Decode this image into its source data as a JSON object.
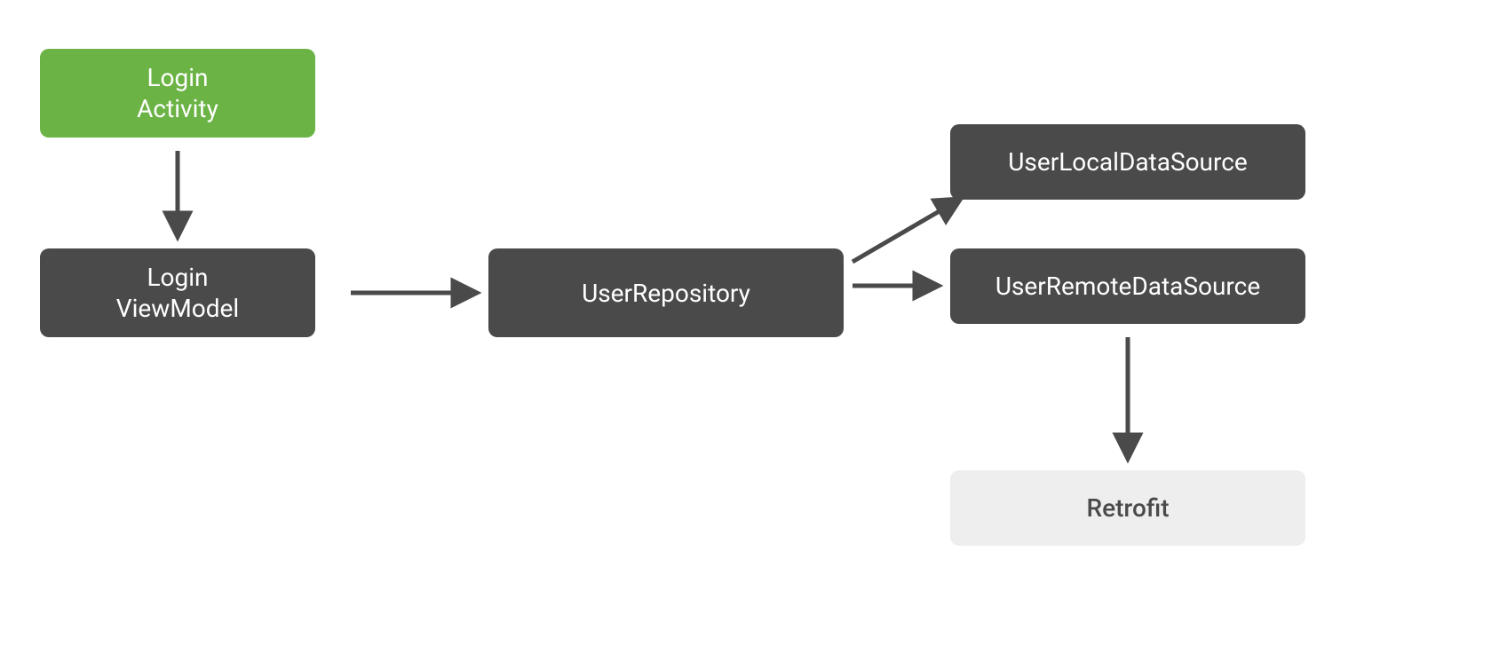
{
  "nodes": {
    "loginActivity": {
      "line1": "Login",
      "line2": "Activity"
    },
    "loginViewModel": {
      "line1": "Login",
      "line2": "ViewModel"
    },
    "userRepository": {
      "label": "UserRepository"
    },
    "userLocal": {
      "label": "UserLocalDataSource"
    },
    "userRemote": {
      "label": "UserRemoteDataSource"
    },
    "retrofit": {
      "label": "Retrofit"
    }
  },
  "diagram": {
    "type": "dependency-graph",
    "edges": [
      {
        "from": "loginActivity",
        "to": "loginViewModel"
      },
      {
        "from": "loginViewModel",
        "to": "userRepository"
      },
      {
        "from": "userRepository",
        "to": "userLocal"
      },
      {
        "from": "userRepository",
        "to": "userRemote"
      },
      {
        "from": "userRemote",
        "to": "retrofit"
      }
    ]
  },
  "colors": {
    "green": "#6ab344",
    "dark": "#4a4a4a",
    "light": "#eeeeee",
    "arrow": "#4a4a4a"
  }
}
